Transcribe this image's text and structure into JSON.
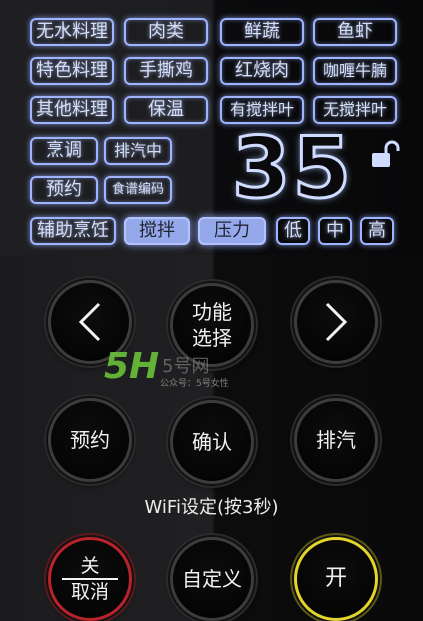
{
  "functions": {
    "row1": [
      "无水料理",
      "肉类",
      "鲜蔬",
      "鱼虾"
    ],
    "row2": [
      "特色料理",
      "手撕鸡",
      "红烧肉",
      "咖喱牛腩"
    ],
    "row3": [
      "其他料理",
      "保温",
      "有搅拌叶",
      "无搅拌叶"
    ]
  },
  "modes": {
    "cook": "烹调",
    "steam_release": "排汽中",
    "schedule": "预约",
    "recipe_code": "食谱编码"
  },
  "assist": {
    "label": "辅助烹饪",
    "stir": "搅拌",
    "pressure": "压力",
    "low": "低",
    "mid": "中",
    "high": "高"
  },
  "display": {
    "digits": "35"
  },
  "buttons": {
    "function_select_line1": "功能",
    "function_select_line2": "选择",
    "schedule": "预约",
    "confirm": "确认",
    "steam": "排汽",
    "off": "关",
    "cancel": "取消",
    "custom": "自定义",
    "on": "开"
  },
  "wifi_label": "WiFi设定(按3秒)",
  "watermark": {
    "logo": "5H",
    "site": "5号网",
    "caption": "公众号：5号女性"
  },
  "colors": {
    "glow": "#9fb4ff",
    "highlight": "#95a8ea",
    "off_ring": "#b8232b",
    "on_ring": "#e1d42a",
    "logo_green": "#69c23a"
  }
}
